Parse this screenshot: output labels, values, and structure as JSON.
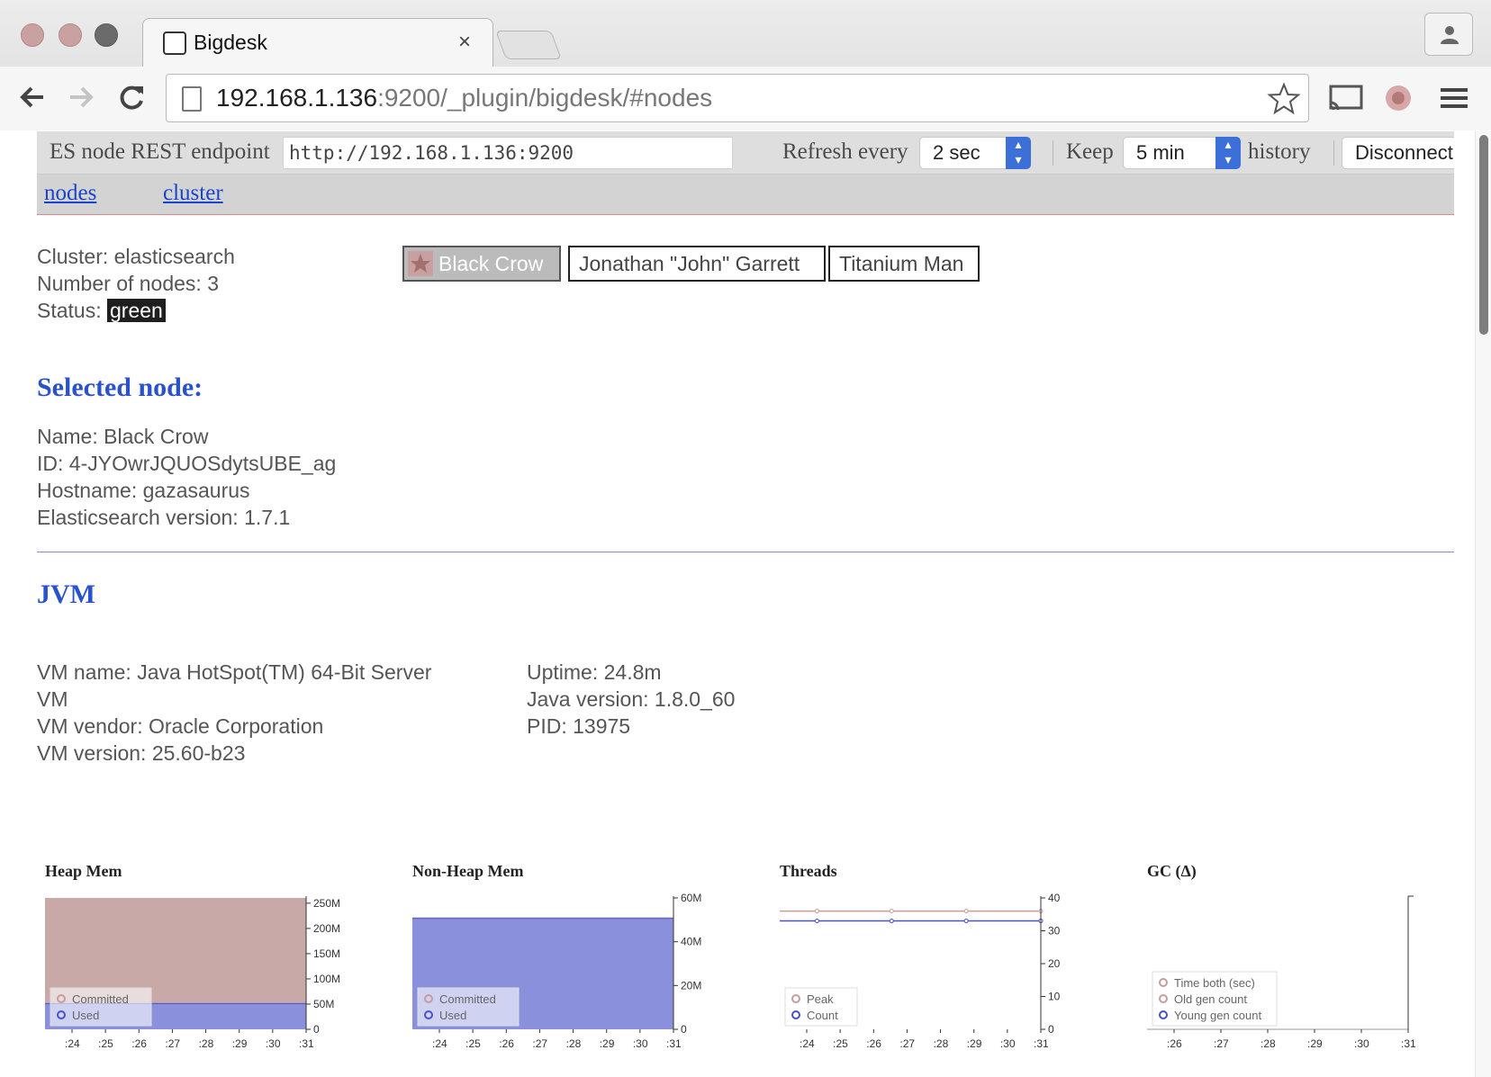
{
  "browser": {
    "tab_title": "Bigdesk",
    "tab_close": "×",
    "url_host": "192.168.1.136",
    "url_rest": ":9200/_plugin/bigdesk/#nodes"
  },
  "controls": {
    "endpoint_label": "ES node REST endpoint",
    "endpoint_value": "http://192.168.1.136:9200",
    "refresh_label": "Refresh every",
    "refresh_value": "2 sec",
    "keep_label": "Keep",
    "keep_value": "5 min",
    "history_label": "history",
    "disconnect_label": "Disconnect"
  },
  "nav": {
    "nodes": "nodes",
    "cluster": "cluster"
  },
  "cluster": {
    "name_line": "Cluster: elasticsearch",
    "nodes_line": "Number of nodes: 3",
    "status_label": "Status:",
    "status_value": "green"
  },
  "nodes": [
    {
      "label": "Black Crow"
    },
    {
      "label": "Jonathan \"John\" Garrett"
    },
    {
      "label": "Titanium Man"
    }
  ],
  "selected_node": {
    "heading": "Selected node:",
    "name": "Name: Black Crow",
    "id": "ID: 4-JYOwrJQUOSdytsUBE_ag",
    "hostname": "Hostname: gazasaurus",
    "version": "Elasticsearch version: 1.7.1"
  },
  "jvm": {
    "heading": "JVM",
    "vm_name_1": "VM name: Java HotSpot(TM) 64-Bit Server",
    "vm_name_2": "VM",
    "vm_vendor": "VM vendor: Oracle Corporation",
    "vm_version": "VM version: 25.60-b23",
    "uptime": "Uptime: 24.8m",
    "java_version": "Java version: 1.8.0_60",
    "pid": "PID: 13975"
  },
  "colors": {
    "committed": "#c9a8a8",
    "used": "#8a90dc",
    "used_line": "#4a52c4",
    "peak_line": "#c89c9c",
    "link": "#1a44cc",
    "heading": "#2952cc"
  },
  "chart_data": [
    {
      "type": "area",
      "title": "Heap Mem",
      "x_ticks": [
        ":24",
        ":25",
        ":26",
        ":27",
        ":28",
        ":29",
        ":30",
        ":31"
      ],
      "y_ticks": [
        "250M",
        "200M",
        "150M",
        "100M",
        "50M",
        "0"
      ],
      "ylim": [
        0,
        260
      ],
      "series": [
        {
          "name": "Committed",
          "values": [
            260,
            260,
            260,
            260,
            260,
            260,
            260,
            260
          ]
        },
        {
          "name": "Used",
          "values": [
            51,
            51,
            51,
            51,
            51,
            51,
            51,
            51
          ]
        }
      ]
    },
    {
      "type": "area",
      "title": "Non-Heap Mem",
      "x_ticks": [
        ":24",
        ":25",
        ":26",
        ":27",
        ":28",
        ":29",
        ":30",
        ":31"
      ],
      "y_ticks": [
        "60M",
        "40M",
        "20M",
        "0"
      ],
      "ylim": [
        0,
        61
      ],
      "series": [
        {
          "name": "Committed",
          "values": [
            52,
            52,
            52,
            52,
            52,
            52,
            52,
            52
          ]
        },
        {
          "name": "Used",
          "values": [
            51.5,
            51.5,
            51.5,
            51.5,
            51.5,
            51.5,
            51.5,
            51.5
          ]
        }
      ]
    },
    {
      "type": "line",
      "title": "Threads",
      "x_ticks": [
        ":24",
        ":25",
        ":26",
        ":27",
        ":28",
        ":29",
        ":30",
        ":31"
      ],
      "y_ticks": [
        "40",
        "30",
        "20",
        "10",
        "0"
      ],
      "ylim": [
        0,
        40
      ],
      "series": [
        {
          "name": "Peak",
          "values": [
            36,
            36,
            36,
            36,
            36,
            36,
            36,
            36
          ]
        },
        {
          "name": "Count",
          "values": [
            33,
            33,
            33,
            33,
            33,
            33,
            33,
            33
          ]
        }
      ]
    },
    {
      "type": "line",
      "title": "GC (Δ)",
      "x_ticks": [
        ":26",
        ":27",
        ":28",
        ":29",
        ":30",
        ":31"
      ],
      "y_ticks": [],
      "series": [
        {
          "name": "Time both (sec)",
          "values": [
            0,
            0,
            0,
            0,
            0,
            0
          ]
        },
        {
          "name": "Old gen count",
          "values": [
            0,
            0,
            0,
            0,
            0,
            0
          ]
        },
        {
          "name": "Young gen count",
          "values": [
            0,
            0,
            0,
            0,
            0,
            0
          ]
        }
      ]
    }
  ]
}
